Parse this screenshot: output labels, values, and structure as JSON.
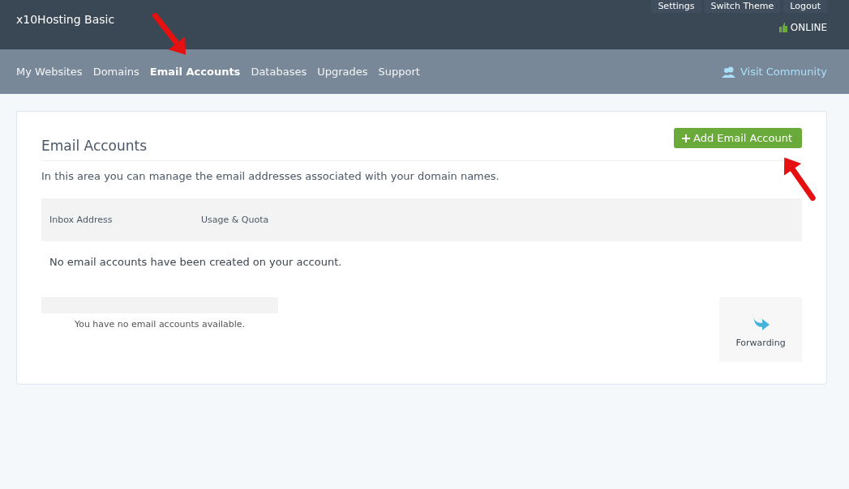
{
  "header": {
    "title": "x10Hosting Basic",
    "top_links": [
      "Settings",
      "Switch Theme",
      "Logout"
    ],
    "status": "ONLINE"
  },
  "nav": {
    "items": [
      {
        "label": "My Websites",
        "selected": false
      },
      {
        "label": "Domains",
        "selected": false
      },
      {
        "label": "Email Accounts",
        "selected": true
      },
      {
        "label": "Databases",
        "selected": false
      },
      {
        "label": "Upgrades",
        "selected": false
      },
      {
        "label": "Support",
        "selected": false
      }
    ],
    "community": "Visit Community"
  },
  "panel": {
    "title": "Email Accounts",
    "add_button": "Add Email Account",
    "intro": "In this area you can manage the email addresses associated with your domain names.",
    "table": {
      "columns": [
        "Inbox Address",
        "Usage & Quota"
      ],
      "empty": "No email accounts have been created on your account."
    },
    "accounts_box": {
      "message": "You have no email accounts available."
    },
    "tools": [
      {
        "label": "Forwarding"
      }
    ]
  }
}
